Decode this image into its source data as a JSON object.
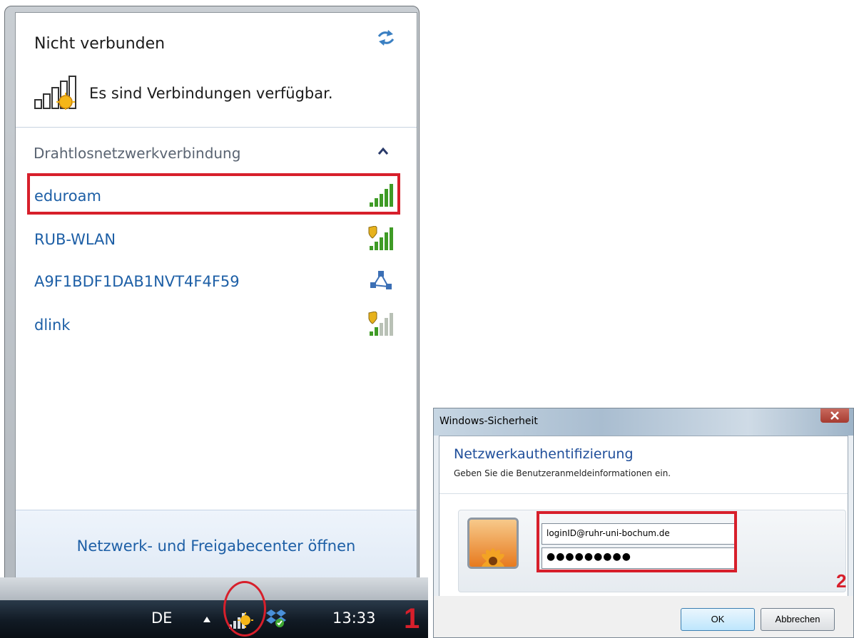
{
  "flyout": {
    "status_title": "Nicht verbunden",
    "connections_text": "Es sind Verbindungen verfügbar.",
    "section_label": "Drahtlosnetzwerkverbindung",
    "networks": [
      {
        "name": "eduroam",
        "secured": false
      },
      {
        "name": "RUB-WLAN",
        "secured": true
      },
      {
        "name": "A9F1BDF1DAB1NVT4F4F59",
        "secured": false
      },
      {
        "name": "dlink",
        "secured": true
      }
    ],
    "footer_link": "Netzwerk- und Freigabecenter öffnen"
  },
  "taskbar": {
    "language": "DE",
    "clock": "13:33"
  },
  "annotations": {
    "step1": "1",
    "step2": "2",
    "highlight_color": "#d71f2b"
  },
  "dialog": {
    "title": "Windows-Sicherheit",
    "heading": "Netzwerkauthentifizierung",
    "subtext": "Geben Sie die Benutzeranmeldeinformationen ein.",
    "username_value": "loginID@ruhr-uni-bochum.de",
    "password_value": "●●●●●●●●●",
    "ok_label": "OK",
    "cancel_label": "Abbrechen"
  },
  "colors": {
    "link_blue": "#1d5fa6",
    "heading_blue": "#1f4e9a"
  }
}
